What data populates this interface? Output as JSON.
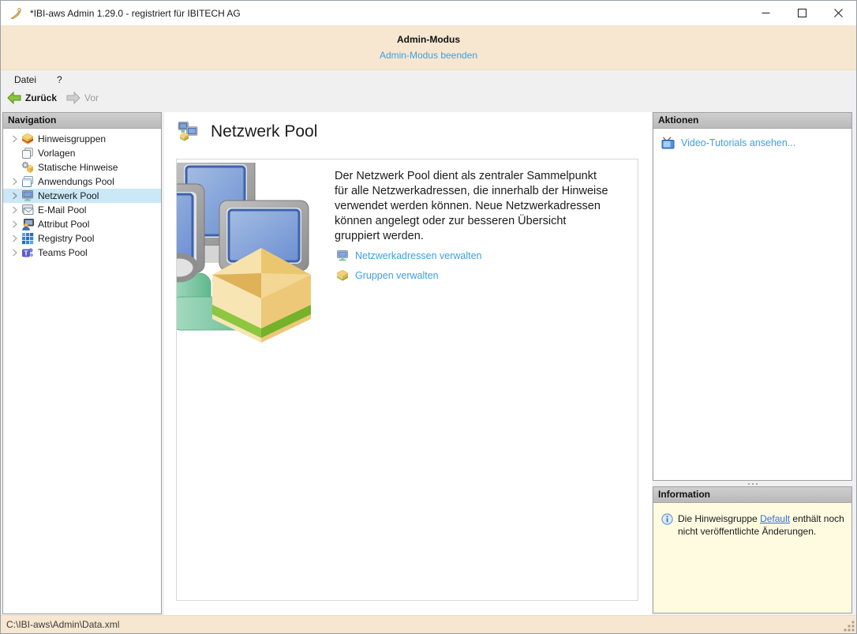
{
  "window": {
    "title": "*IBI-aws Admin 1.29.0 - registriert für IBITECH AG",
    "app_icon": "ibi-aws-app-icon",
    "controls": [
      {
        "icon": "minimize-icon"
      },
      {
        "icon": "maximize-icon"
      },
      {
        "icon": "close-icon"
      }
    ]
  },
  "admin_banner": {
    "title": "Admin-Modus",
    "exit_link": "Admin-Modus beenden"
  },
  "menubar": {
    "items": [
      {
        "label": "Datei"
      },
      {
        "label": "?"
      }
    ]
  },
  "toolbar": {
    "back_label": "Zurück",
    "back_icon": "back-arrow-icon",
    "forward_label": "Vor",
    "forward_icon": "forward-arrow-icon"
  },
  "navigation": {
    "header": "Navigation",
    "items": [
      {
        "label": "Hinweisgruppen",
        "icon": "notice-groups-icon",
        "expandable": true,
        "selected": false
      },
      {
        "label": "Vorlagen",
        "icon": "templates-icon",
        "expandable": false,
        "selected": false
      },
      {
        "label": "Statische Hinweise",
        "icon": "static-notices-icon",
        "expandable": false,
        "selected": false
      },
      {
        "label": "Anwendungs Pool",
        "icon": "application-pool-icon",
        "expandable": true,
        "selected": false
      },
      {
        "label": "Netzwerk Pool",
        "icon": "network-pool-icon",
        "expandable": true,
        "selected": true
      },
      {
        "label": "E-Mail Pool",
        "icon": "email-pool-icon",
        "expandable": true,
        "selected": false
      },
      {
        "label": "Attribut Pool",
        "icon": "attribute-pool-icon",
        "expandable": true,
        "selected": false
      },
      {
        "label": "Registry Pool",
        "icon": "registry-pool-icon",
        "expandable": true,
        "selected": false
      },
      {
        "label": "Teams Pool",
        "icon": "teams-pool-icon",
        "expandable": true,
        "selected": false
      }
    ]
  },
  "content": {
    "title": "Netzwerk Pool",
    "header_icon": "network-pool-header-icon",
    "illustration": "network-pool-illustration",
    "description": "Der Netzwerk Pool dient als zentraler Sammelpunkt\nfür alle Netzwerkadressen, die innerhalb der Hinweise\nverwendet werden können. Neue Netzwerkadressen\nkönnen angelegt oder zur besseren Übersicht\ngruppiert werden.",
    "links": [
      {
        "label": "Netzwerkadressen verwalten",
        "icon": "monitor-icon"
      },
      {
        "label": "Gruppen verwalten",
        "icon": "package-icon"
      }
    ]
  },
  "actions": {
    "header": "Aktionen",
    "video_link": "Video-Tutorials ansehen...",
    "video_icon": "tv-icon"
  },
  "information": {
    "header": "Information",
    "icon": "info-icon",
    "text_before": "Die Hinweisgruppe ",
    "link_text": "Default",
    "text_after": " enthält noch nicht veröffentlichte Änderungen."
  },
  "statusbar": {
    "path": "C:\\IBI-aws\\Admin\\Data.xml"
  },
  "colors": {
    "banner_bg": "#f7e7d1",
    "chrome_bg": "#f0f0f0",
    "panel_header_bg": "#c4c4c4",
    "selection_bg": "#cbe8f6",
    "link_blue": "#3e9fe0",
    "info_link_blue": "#2f6fd6",
    "info_bg": "#fffbe1",
    "back_arrow_green": "#8bc53f",
    "screen_blue": "#86a8dc",
    "box_yellow": "#f0d292",
    "stripe_green": "#8dc63f",
    "pipe_teal": "#7cc9a8"
  }
}
